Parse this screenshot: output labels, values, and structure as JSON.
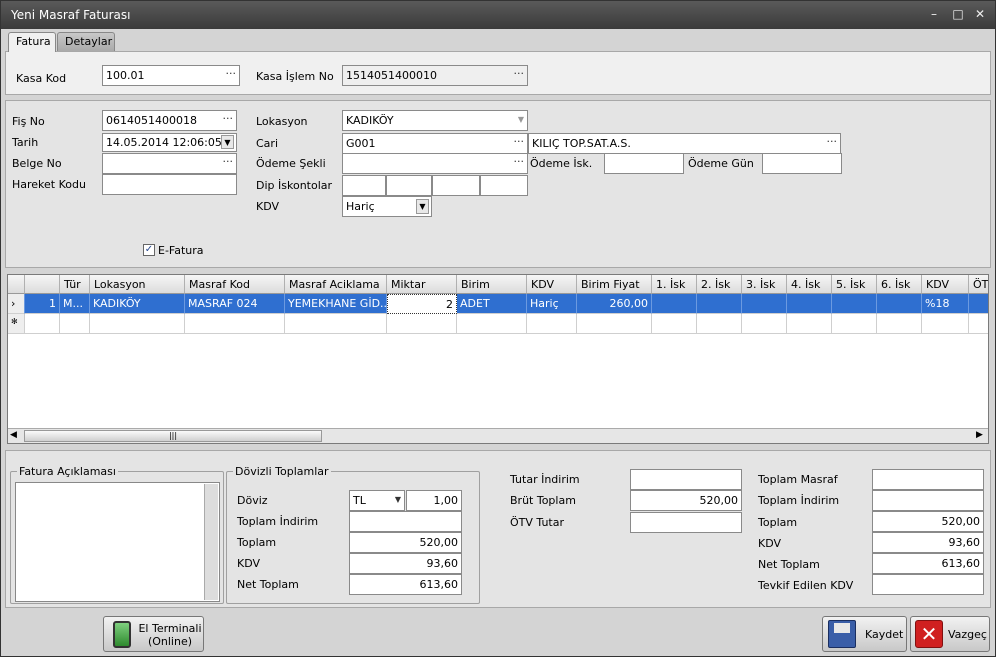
{
  "window": {
    "title": "Yeni Masraf Faturası",
    "min": "–",
    "max": "□",
    "close": "✕"
  },
  "tabs": [
    {
      "label": "Fatura"
    },
    {
      "label": "Detaylar"
    }
  ],
  "header": {
    "kasa_kod_label": "Kasa Kod",
    "kasa_kod": "100.01",
    "kasa_islem_label": "Kasa İşlem No",
    "kasa_islem": "1514051400010"
  },
  "form": {
    "fis_no_label": "Fiş No",
    "fis_no": "0614051400018",
    "tarih_label": "Tarih",
    "tarih": "14.05.2014 12:06:05",
    "belge_no_label": "Belge No",
    "belge_no": "",
    "hareket_kodu_label": "Hareket Kodu",
    "hareket_kodu": "",
    "lokasyon_label": "Lokasyon",
    "lokasyon": "KADIKÖY",
    "cari_label": "Cari",
    "cari_kod": "G001",
    "cari_ad": "KILIÇ TOP.SAT.A.S.",
    "odeme_sekli_label": "Ödeme Şekli",
    "odeme_sekli": "",
    "odeme_isk_label": "Ödeme İsk.",
    "odeme_isk": "",
    "odeme_gun_label": "Ödeme Gün",
    "odeme_gun": "",
    "dip_iskontolar_label": "Dip İskontolar",
    "kdv_label": "KDV",
    "kdv": "Hariç",
    "efatura_label": "E-Fatura",
    "efatura_checked": "✓"
  },
  "grid": {
    "headers": [
      "",
      "",
      "Tür",
      "Lokasyon",
      "Masraf Kod",
      "Masraf Aciklama",
      "Miktar",
      "Birim",
      "KDV",
      "Birim Fiyat",
      "1. İsk",
      "2. İsk",
      "3. İsk",
      "4. İsk",
      "5. İsk",
      "6. İsk",
      "KDV",
      "ÖTV"
    ],
    "rows": [
      [
        "›",
        "1",
        "M...",
        "KADIKÖY",
        "MASRAF 024",
        "YEMEKHANE GİD...",
        "2",
        "ADET",
        "Hariç",
        "260,00",
        "",
        "",
        "",
        "",
        "",
        "",
        "%18",
        ""
      ]
    ],
    "new_row_marker": "✻",
    "scroll_left": "◀",
    "scroll_right": "▶",
    "scroll_thumb": "|||"
  },
  "aciklama": {
    "title": "Fatura Açıklaması",
    "text": ""
  },
  "dovizli": {
    "title": "Dövizli Toplamlar",
    "doviz_label": "Döviz",
    "doviz": "TL",
    "kur": "1,00",
    "toplam_indirim_label": "Toplam İndirim",
    "toplam_indirim": "",
    "toplam_label": "Toplam",
    "toplam": "520,00",
    "kdv_label": "KDV",
    "kdv": "93,60",
    "net_label": "Net Toplam",
    "net": "613,60"
  },
  "mid_totals": {
    "tutar_indirim_label": "Tutar İndirim",
    "tutar_indirim": "",
    "brut_label": "Brüt Toplam",
    "brut": "520,00",
    "otv_label": "ÖTV Tutar",
    "otv": ""
  },
  "right_totals": {
    "toplam_masraf_label": "Toplam Masraf",
    "toplam_masraf": "",
    "toplam_indirim_label": "Toplam İndirim",
    "toplam_indirim": "",
    "toplam_label": "Toplam",
    "toplam": "520,00",
    "kdv_label": "KDV",
    "kdv": "93,60",
    "net_label": "Net Toplam",
    "net": "613,60",
    "tevkif_label": "Tevkif Edilen KDV",
    "tevkif": ""
  },
  "buttons": {
    "el_terminali": "El Terminali",
    "el_terminali_sub": "(Online)",
    "kaydet": "Kaydet",
    "vazgec": "Vazgeç"
  },
  "colors": {
    "selection": "#2f6fd0",
    "titlebar": "#3a3a3a"
  }
}
